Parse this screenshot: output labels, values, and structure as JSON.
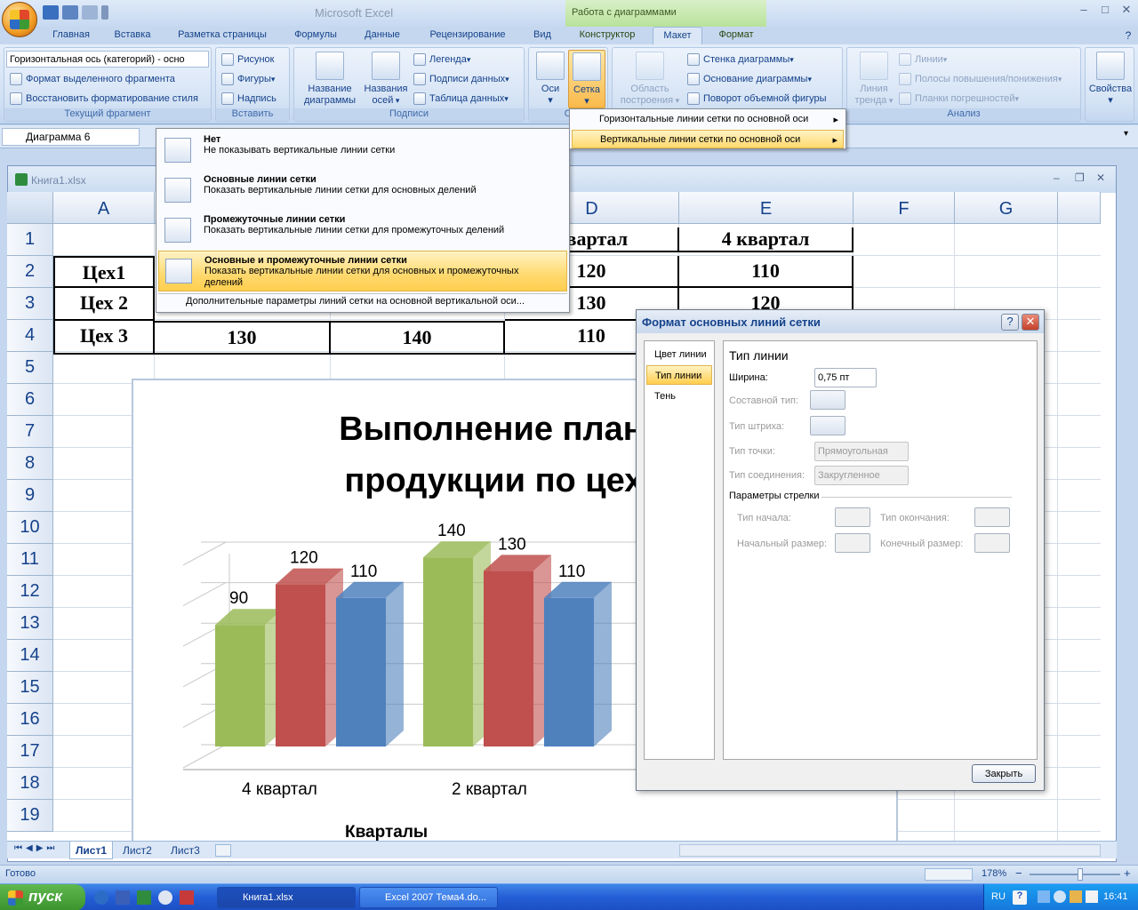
{
  "window": {
    "app_title": "Microsoft Excel",
    "context_group": "Работа с диаграммами",
    "minimize": "–",
    "maximize": "□",
    "close": "✕"
  },
  "tabs": [
    "Главная",
    "Вставка",
    "Разметка страницы",
    "Формулы",
    "Данные",
    "Рецензирование",
    "Вид",
    "Конструктор",
    "Макет",
    "Формат"
  ],
  "active_tab": "Макет",
  "ribbon": {
    "current_fragment": {
      "select_value": "Горизонтальная ось (категорий)  - осно",
      "format_selection": "Формат выделенного фрагмента",
      "reset_style": "Восстановить форматирование стиля",
      "label": "Текущий фрагмент"
    },
    "insert": {
      "picture": "Рисунок",
      "shapes": "Фигуры",
      "textbox": "Надпись",
      "label": "Вставить"
    },
    "labels": {
      "chart_title_l1": "Название",
      "chart_title_l2": "диаграммы",
      "axis_titles_l1": "Названия",
      "axis_titles_l2": "осей",
      "legend": "Легенда",
      "data_labels": "Подписи данных",
      "data_table": "Таблица данных",
      "label": "Подписи"
    },
    "axes": {
      "axes": "Оси",
      "gridlines": "Сетка",
      "label_short": "О"
    },
    "background": {
      "plot_area_l1": "Область",
      "plot_area_l2": "построения",
      "chart_wall": "Стенка диаграммы",
      "chart_floor": "Основание диаграммы",
      "rotation": "Поворот объемной фигуры"
    },
    "analysis": {
      "trendline_l1": "Линия",
      "trendline_l2": "тренда",
      "lines": "Линии",
      "updown_bars": "Полосы повышения/понижения",
      "error_bars": "Планки погрешностей",
      "label": "Анализ"
    },
    "properties": "Свойства"
  },
  "formula_bar": {
    "name_box": "Диаграмма 6"
  },
  "workbook": {
    "title": "Книга1.xlsx"
  },
  "columns": [
    "A",
    "B",
    "C",
    "D",
    "E",
    "F",
    "G"
  ],
  "rows": [
    "1",
    "2",
    "3",
    "4",
    "5",
    "6",
    "7",
    "8",
    "9",
    "10",
    "11",
    "12",
    "13",
    "14",
    "15",
    "16",
    "17",
    "18",
    "19"
  ],
  "cells": {
    "d1": "квартал",
    "e1": "4 квартал",
    "a2": "Цех1",
    "d2": "120",
    "e2": "110",
    "a3": "Цех 2",
    "d3": "130",
    "e3": "120",
    "a4": "Цех 3",
    "b4": "130",
    "c4": "140",
    "d4": "110"
  },
  "gridlines_menu": {
    "items": [
      {
        "title": "Нет",
        "desc": "Не показывать вертикальные линии сетки"
      },
      {
        "title": "Основные линии сетки",
        "desc": "Показать вертикальные линии сетки для основных делений"
      },
      {
        "title": "Промежуточные линии сетки",
        "desc": "Показать вертикальные линии сетки для промежуточных делений"
      },
      {
        "title": "Основные и промежуточные линии сетки",
        "desc": "Показать вертикальные линии сетки для основных и промежуточных делений"
      }
    ],
    "more": "Дополнительные параметры линий сетки на основной вертикальной оси..."
  },
  "submenu": {
    "horizontal": "Горизонтальные линии сетки по основной оси",
    "vertical": "Вертикальные линии сетки по основной оси"
  },
  "chart_data": {
    "type": "bar",
    "title_line1": "Выполнение плана в",
    "title_line2": "продукции по цехам",
    "categories": [
      "4 квартал",
      "2 квартал"
    ],
    "series": [
      {
        "values": [
          90,
          140
        ],
        "color": "#9bbb59"
      },
      {
        "values": [
          120,
          130
        ],
        "color": "#c0504d"
      },
      {
        "values": [
          110,
          110
        ],
        "color": "#4f81bd"
      }
    ],
    "xlabel": "Кварталы"
  },
  "dialog": {
    "title": "Формат основных линий сетки",
    "help": "?",
    "nav": [
      "Цвет линии",
      "Тип линии",
      "Тень"
    ],
    "panel_title": "Тип линии",
    "width_label": "Ширина:",
    "width_value": "0,75 пт",
    "compound_label": "Составной тип:",
    "dash_label": "Тип штриха:",
    "cap_label": "Тип точки:",
    "cap_value": "Прямоугольная",
    "join_label": "Тип соединения:",
    "join_value": "Закругленное",
    "arrow_section": "Параметры стрелки",
    "begin_type": "Тип начала:",
    "end_type": "Тип окончания:",
    "begin_size": "Начальный размер:",
    "end_size": "Конечный размер:",
    "close": "Закрыть"
  },
  "sheets": [
    "Лист1",
    "Лист2",
    "Лист3"
  ],
  "status": {
    "ready": "Готово",
    "zoom": "178%",
    "minus": "−",
    "plus": "+"
  },
  "taskbar": {
    "start": "пуск",
    "tasks": [
      "Книга1.xlsx",
      "Excel 2007 Тема4.do..."
    ],
    "lang": "RU",
    "time": "16:41"
  }
}
